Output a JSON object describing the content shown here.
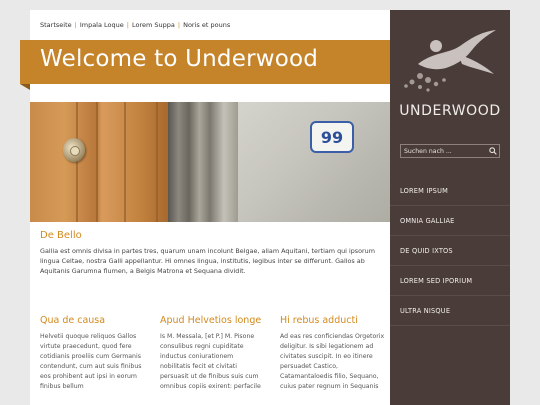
{
  "breadcrumb": [
    "Startseite",
    "Impala Loque",
    "Lorem Suppa",
    "Noris et pouns"
  ],
  "banner": {
    "title": "Welcome to Underwood"
  },
  "hero": {
    "house_number": "99"
  },
  "intro": {
    "heading": "De Bello",
    "text": "Gallia est omnis divisa in partes tres, quarum unam incolunt Belgae, aliam Aquitani, tertiam qui ipsorum lingua Celtae, nostra Galli appellantur. Hi omnes lingua, institutis, legibus inter se differunt. Gallos ab Aquitanis Garumna flumen, a Belgis Matrona et Sequana dividit."
  },
  "columns": [
    {
      "heading": "Qua de causa",
      "text": "Helvetii quoque reliquos Gallos virtute praecedunt, quod fere cotidianis proeliis cum Germanis contendunt, cum aut suis finibus eos prohibent aut ipsi in eorum finibus bellum"
    },
    {
      "heading": "Apud Helvetios longe",
      "text": "Is M. Messala, [et P.] M. Pisone consulibus regni cupiditate inductus coniurationem nobilitatis fecit et civitati persuasit ut de finibus suis cum omnibus copiis exirent: perfacile"
    },
    {
      "heading": "Hi rebus adducti",
      "text": "Ad eas res conficiendas Orgetorix deligitur. Is sibi legationem ad civitates suscipit. In eo itinere persuadet Castico, Catamantaloedis filio, Sequano, cuius pater regnum in Sequanis"
    }
  ],
  "sidebar": {
    "brand": "UNDERWOOD",
    "search_placeholder": "Suchen nach ...",
    "nav": [
      "LOREM IPSUM",
      "OMNIA GALLIAE",
      "DE QUID IXTOS",
      "LOREM SED IPORIUM",
      "ULTRA NISQUE"
    ]
  },
  "colors": {
    "accent": "#c5832a",
    "sidebar": "#4a3d39",
    "heading": "#d28a1e",
    "background": "#e9e9e9"
  },
  "icons": {
    "search_button": "search-icon",
    "logo": "swimmer-logo-icon"
  }
}
